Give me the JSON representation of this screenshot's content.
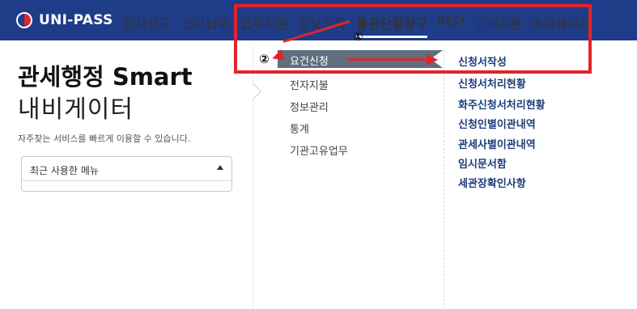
{
  "brand": {
    "name": "UNI-PASS"
  },
  "nav": {
    "items": [
      {
        "label": "전자신고"
      },
      {
        "label": "전자납부"
      },
      {
        "label": "업무지원"
      },
      {
        "label": "정보조회"
      },
      {
        "label": "통관단일창구"
      },
      {
        "label": "AEO"
      },
      {
        "label": "고객지원"
      },
      {
        "label": "마이페이지"
      }
    ],
    "active": "통관단일창구"
  },
  "left": {
    "title_line1": "관세행정 Smart",
    "title_line2": "내비게이터",
    "subtitle": "자주찾는 서비스를 빠르게 이용할 수 있습니다.",
    "recent_menu_label": "최근 사용한 메뉴"
  },
  "menu_level2": {
    "items": [
      {
        "label": "요건신청",
        "active": true
      },
      {
        "label": "전자지불"
      },
      {
        "label": "정보관리"
      },
      {
        "label": "통계"
      },
      {
        "label": "기관고유업무"
      }
    ]
  },
  "menu_level3": {
    "items": [
      {
        "label": "신청서작성"
      },
      {
        "label": "신청서처리현황"
      },
      {
        "label": "화주신청서처리현황"
      },
      {
        "label": "신청인별이관내역"
      },
      {
        "label": "관세사별이관내역"
      },
      {
        "label": "임시문서함"
      },
      {
        "label": "세관장확인사항"
      }
    ]
  },
  "annotations": {
    "marker1": "①",
    "marker2": "②",
    "color": "#e0242c"
  },
  "colors": {
    "topbar": "#1f3c88",
    "menu_active_bg": "#5f6f80",
    "menu3_text": "#1d3d78"
  }
}
